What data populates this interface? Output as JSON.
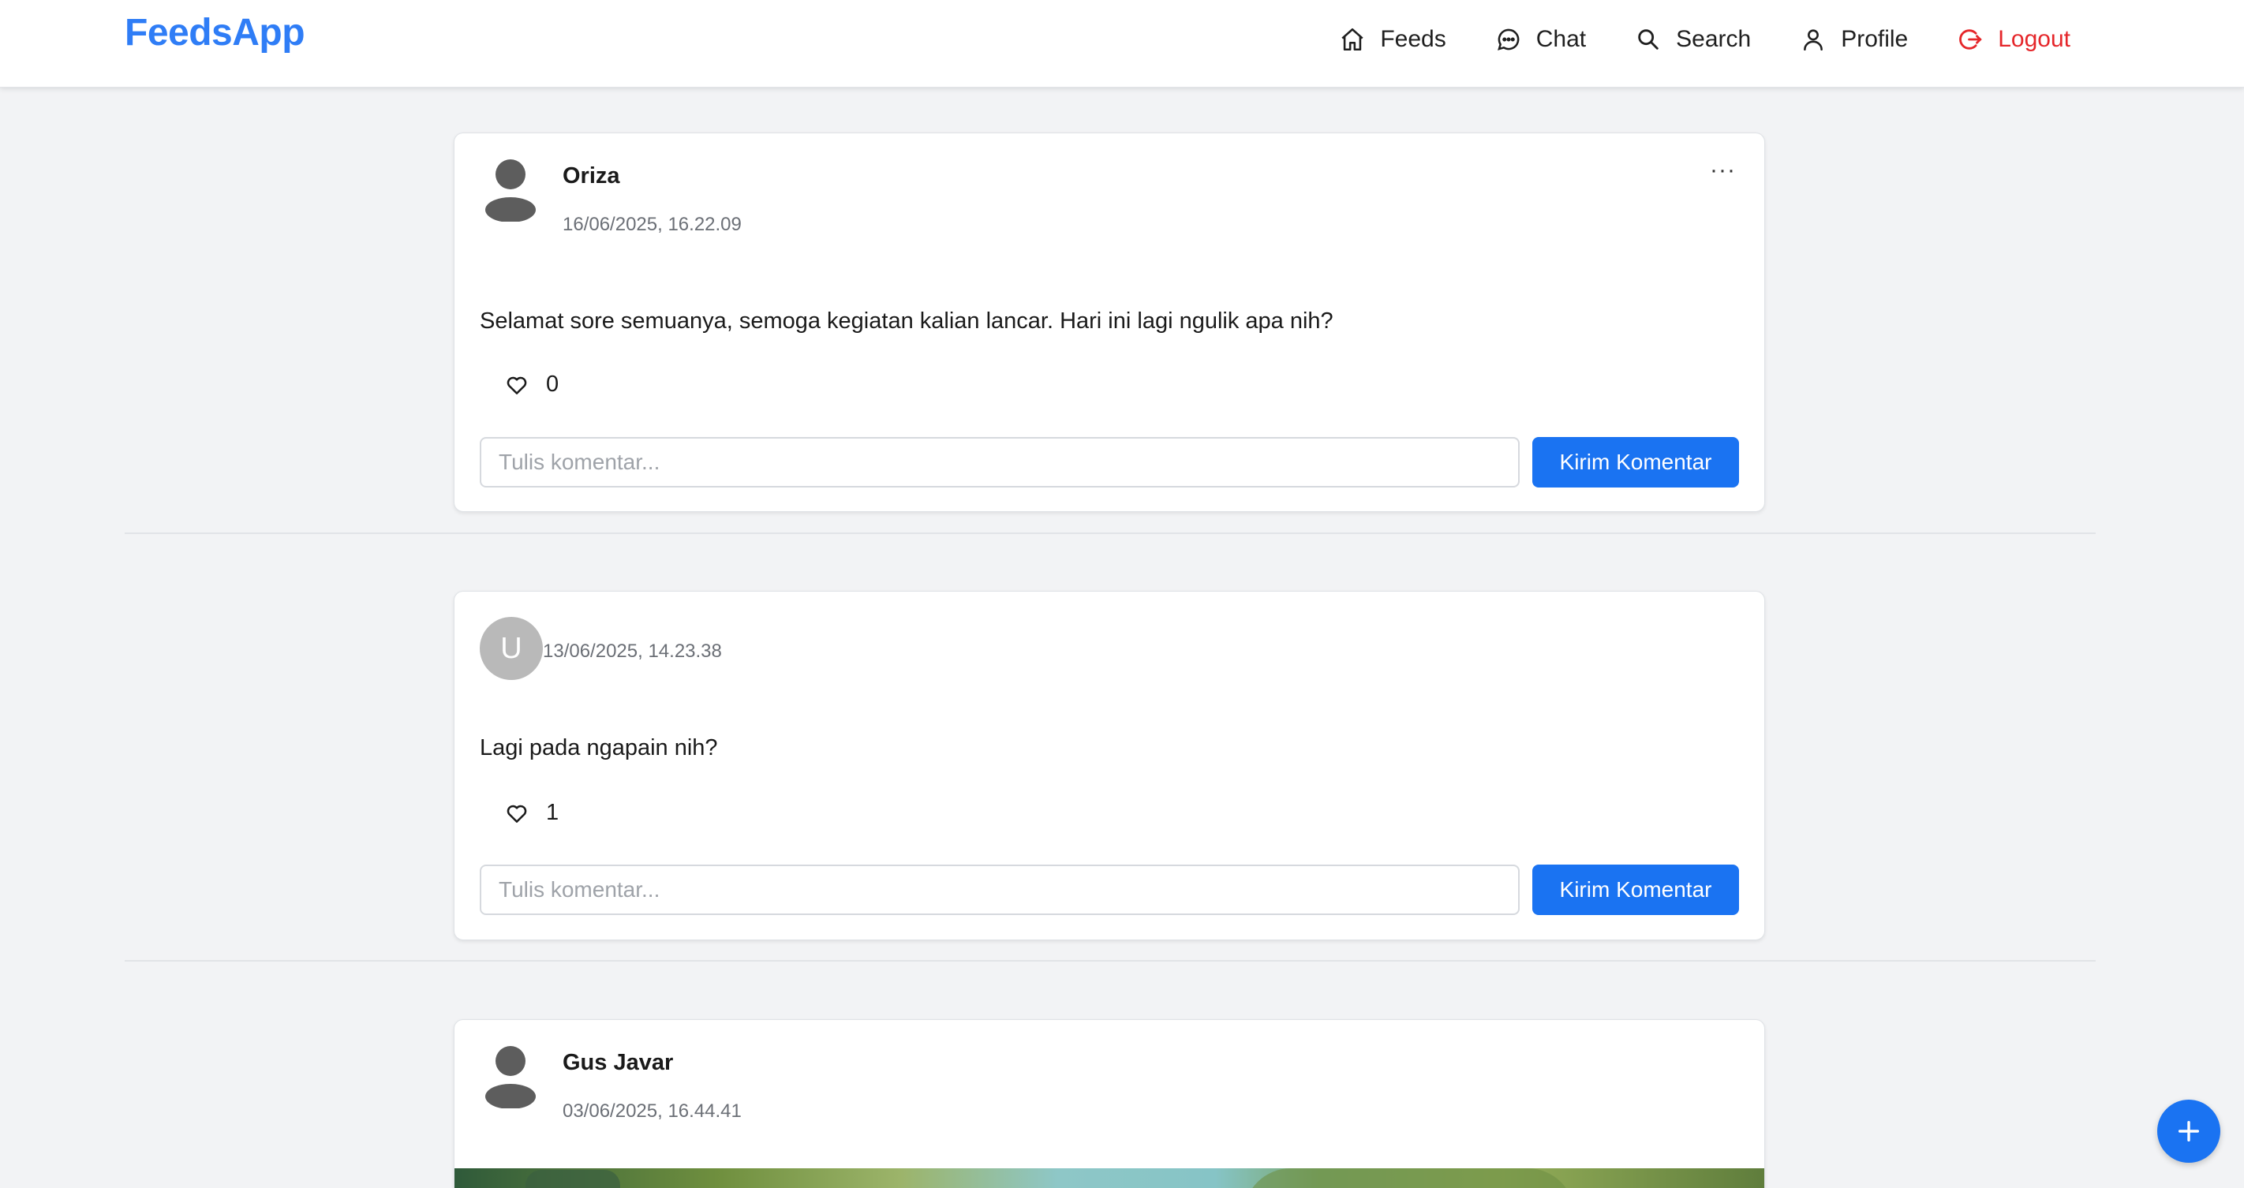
{
  "app": {
    "brand": "FeedsApp"
  },
  "nav": {
    "items": [
      {
        "label": "Feeds",
        "icon": "home-icon"
      },
      {
        "label": "Chat",
        "icon": "chat-icon"
      },
      {
        "label": "Search",
        "icon": "search-icon"
      },
      {
        "label": "Profile",
        "icon": "user-icon"
      },
      {
        "label": "Logout",
        "icon": "logout-icon"
      }
    ]
  },
  "posts": [
    {
      "author": "Oriza",
      "timestamp": "16/06/2025, 16.22.09",
      "content": "Selamat sore semuanya, semoga kegiatan kalian lancar. Hari ini lagi ngulik apa nih?",
      "likes": "0",
      "more_label": "···",
      "comment_placeholder": "Tulis komentar...",
      "comment_button": "Kirim Komentar"
    },
    {
      "author_initial": "U",
      "timestamp": "13/06/2025, 14.23.38",
      "content": "Lagi pada ngapain nih?",
      "likes": "1",
      "comment_placeholder": "Tulis komentar...",
      "comment_button": "Kirim Komentar"
    },
    {
      "author": "Gus Javar",
      "timestamp": "03/06/2025, 16.44.41"
    }
  ],
  "fab_icon": "plus-icon",
  "colors": {
    "brand": "#2f7df6",
    "primary": "#1a73f2",
    "logout": "#e5262a",
    "background": "#f2f3f5"
  }
}
